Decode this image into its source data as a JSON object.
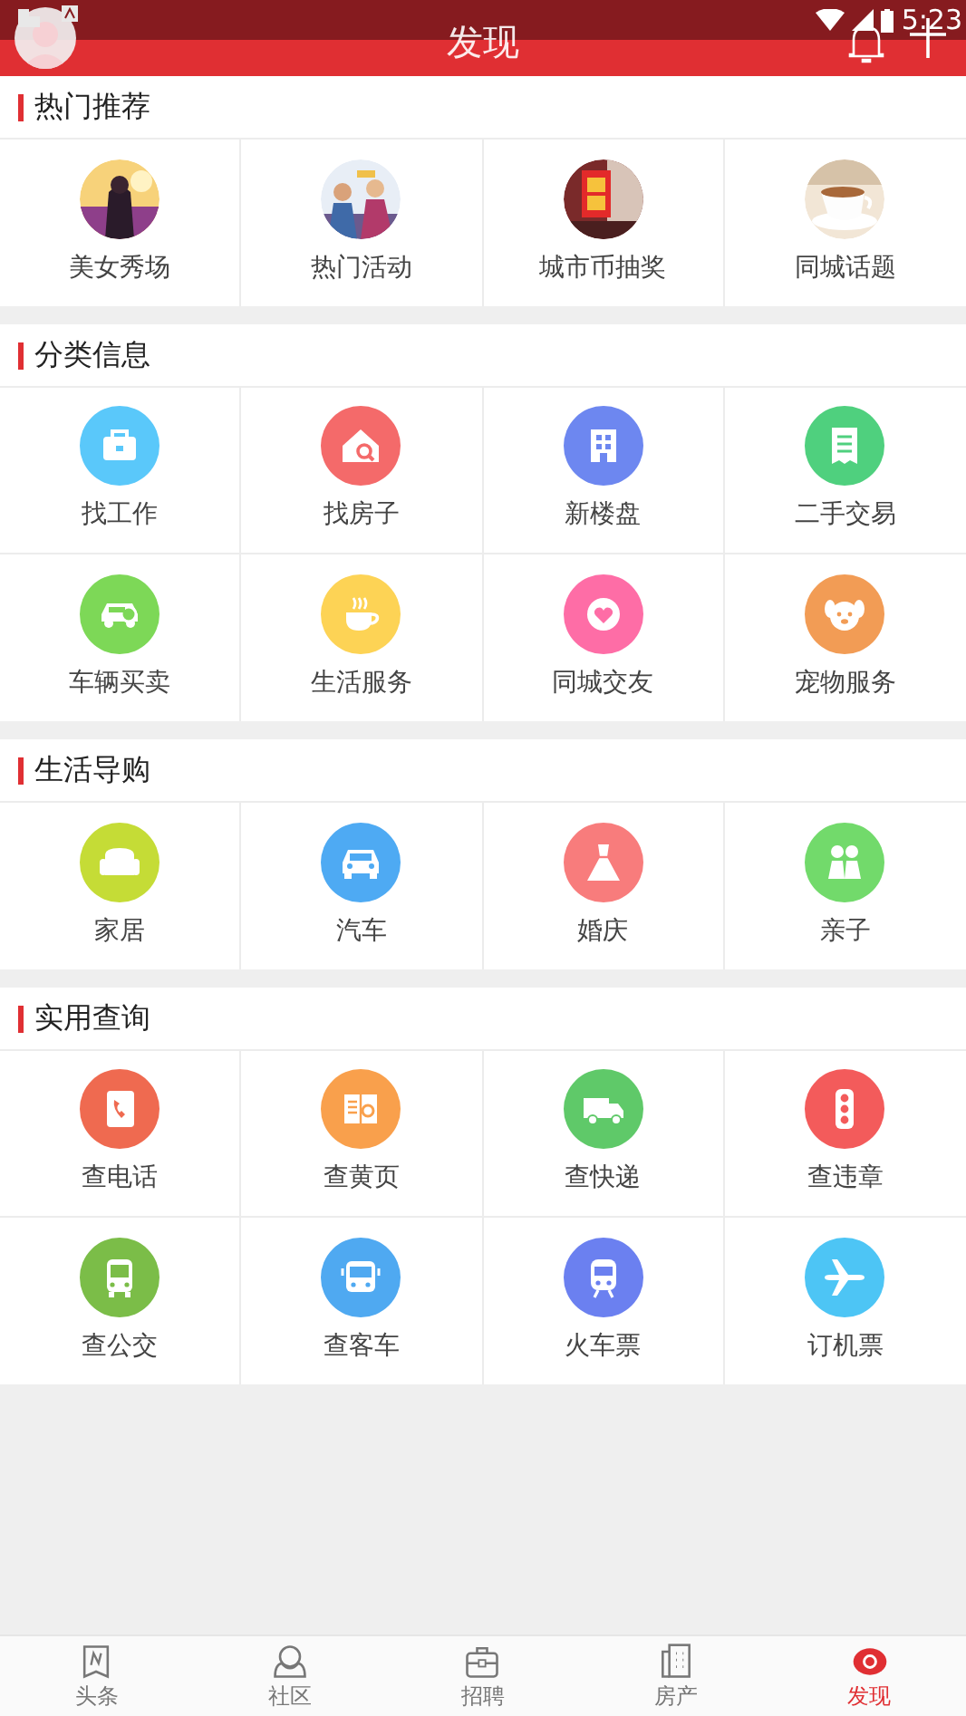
{
  "status_bar": {
    "time": "5:23"
  },
  "header": {
    "title": "发现"
  },
  "sections": [
    {
      "title": "热门推荐",
      "kind": "pictures",
      "items": [
        {
          "label": "美女秀场"
        },
        {
          "label": "热门活动"
        },
        {
          "label": "城市币抽奖"
        },
        {
          "label": "同城话题"
        }
      ]
    },
    {
      "title": "分类信息",
      "kind": "icons",
      "items": [
        {
          "label": "找工作",
          "color": "#5ac8fa"
        },
        {
          "label": "找房子",
          "color": "#f46a6a"
        },
        {
          "label": "新楼盘",
          "color": "#6d87f0"
        },
        {
          "label": "二手交易",
          "color": "#4fd07e"
        },
        {
          "label": "车辆买卖",
          "color": "#7dd857"
        },
        {
          "label": "生活服务",
          "color": "#fdd355"
        },
        {
          "label": "同城交友",
          "color": "#fe6da6"
        },
        {
          "label": "宠物服务",
          "color": "#f29c55"
        }
      ]
    },
    {
      "title": "生活导购",
      "kind": "icons",
      "items": [
        {
          "label": "家居",
          "color": "#c5dc36"
        },
        {
          "label": "汽车",
          "color": "#4eaaf3"
        },
        {
          "label": "婚庆",
          "color": "#f87c7c"
        },
        {
          "label": "亲子",
          "color": "#72da6b"
        }
      ]
    },
    {
      "title": "实用查询",
      "kind": "icons",
      "items": [
        {
          "label": "查电话",
          "color": "#ef6a50"
        },
        {
          "label": "查黄页",
          "color": "#f9a04c"
        },
        {
          "label": "查快递",
          "color": "#5fc969"
        },
        {
          "label": "查违章",
          "color": "#f35b5b"
        },
        {
          "label": "查公交",
          "color": "#7bbd48"
        },
        {
          "label": "查客车",
          "color": "#4fa9f1"
        },
        {
          "label": "火车票",
          "color": "#6b80f0"
        },
        {
          "label": "订机票",
          "color": "#4dc5f5"
        }
      ]
    }
  ],
  "bottom_nav": [
    {
      "label": "头条",
      "selected": false
    },
    {
      "label": "社区",
      "selected": false
    },
    {
      "label": "招聘",
      "selected": false
    },
    {
      "label": "房产",
      "selected": false
    },
    {
      "label": "发现",
      "selected": true
    }
  ]
}
